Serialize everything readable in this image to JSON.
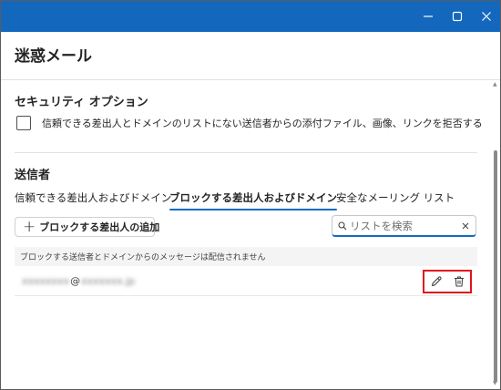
{
  "window": {
    "title_bar_color": "#1368bd",
    "controls": {
      "minimize_icon": "minimize-icon",
      "maximize_icon": "maximize-icon",
      "close_icon": "close-icon"
    }
  },
  "header": {
    "title": "迷惑メール"
  },
  "security_options": {
    "title": "セキュリティ オプション",
    "checkbox": {
      "label": "信頼できる差出人とドメインのリストにない送信者からの添付ファイル、画像、リンクを拒否する",
      "checked": false
    }
  },
  "senders": {
    "title": "送信者",
    "tabs": [
      {
        "label": "信頼できる差出人およびドメイン",
        "active": false
      },
      {
        "label": "ブロックする差出人およびドメイン",
        "active": true
      },
      {
        "label": "安全なメーリング リスト",
        "active": false
      }
    ],
    "add_button": {
      "label": "ブロックする差出人の追加",
      "icon": "plus-icon"
    },
    "search": {
      "placeholder": "リストを検索",
      "value": "",
      "icon": "search-icon",
      "clear_icon": "clear-icon"
    },
    "list_header": "ブロックする送信者とドメインからのメッセージは配信されません",
    "entries": [
      {
        "local_part": "xxxxxxxx",
        "at": "@",
        "domain": "xxxxxxx.jp",
        "edit_icon": "edit-pencil-icon",
        "delete_icon": "delete-trash-icon"
      }
    ]
  },
  "accent_color": "#0f6cbd",
  "highlight_color": "#e0141e"
}
